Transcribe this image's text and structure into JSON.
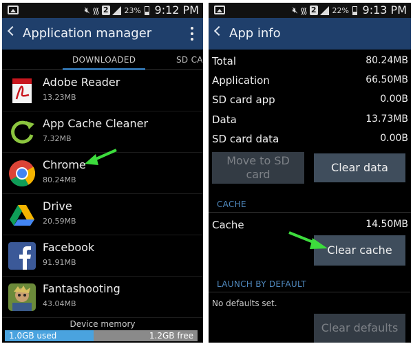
{
  "left": {
    "status": {
      "battery": "23%",
      "time": "9:12 PM",
      "sim": "2"
    },
    "title": "Application manager",
    "tabs": {
      "downloaded": "DOWNLOADED",
      "sdcard": "SD CAR"
    },
    "apps": [
      {
        "name": "Adobe Reader",
        "size": "13.23MB",
        "icon": "adobe-reader-icon"
      },
      {
        "name": "App Cache Cleaner",
        "size": "7.32MB",
        "icon": "app-cache-cleaner-icon"
      },
      {
        "name": "Chrome",
        "size": "80.24MB",
        "icon": "chrome-icon"
      },
      {
        "name": "Drive",
        "size": "20.59MB",
        "icon": "drive-icon"
      },
      {
        "name": "Facebook",
        "size": "91.91MB",
        "icon": "facebook-icon"
      },
      {
        "name": "Fantashooting",
        "size": "43.04MB",
        "icon": "fantashooting-icon"
      }
    ],
    "memory": {
      "label": "Device memory",
      "used": "1.0GB used",
      "free": "1.2GB free",
      "used_fraction": 0.46
    }
  },
  "right": {
    "status": {
      "battery": "22%",
      "time": "9:13 PM",
      "sim": "2"
    },
    "title": "App info",
    "storage": [
      {
        "label": "Total",
        "value": "80.24MB"
      },
      {
        "label": "Application",
        "value": "66.50MB"
      },
      {
        "label": "SD card app",
        "value": "0.00B"
      },
      {
        "label": "Data",
        "value": "13.73MB"
      },
      {
        "label": "SD card data",
        "value": "0.00B"
      }
    ],
    "buttons": {
      "move_to_sd": "Move to SD card",
      "clear_data": "Clear data",
      "clear_cache": "Clear cache",
      "clear_defaults": "Clear defaults"
    },
    "cache_header": "CACHE",
    "cache": {
      "label": "Cache",
      "value": "14.50MB"
    },
    "launch_header": "LAUNCH BY DEFAULT",
    "no_defaults": "No defaults set."
  },
  "colors": {
    "actionbar": "#1f3f6b",
    "accent": "#4f88bd",
    "arrow": "#3ddc3d",
    "memory_used": "#4aa3df"
  }
}
